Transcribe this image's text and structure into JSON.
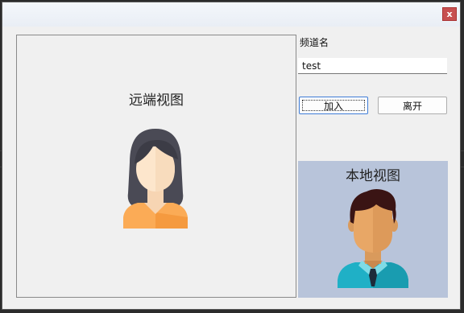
{
  "window": {
    "close_label": "x"
  },
  "remote": {
    "label": "远端视图",
    "avatar_icon": "female-user-avatar-icon"
  },
  "channel": {
    "label": "频道名",
    "value": "test"
  },
  "buttons": {
    "join_label": "加入",
    "leave_label": "离开"
  },
  "local": {
    "label": "本地视图",
    "avatar_icon": "male-user-avatar-icon",
    "background": "#b8c4da"
  },
  "colors": {
    "close_button": "#c75050",
    "accent": "#3d7bd6"
  }
}
